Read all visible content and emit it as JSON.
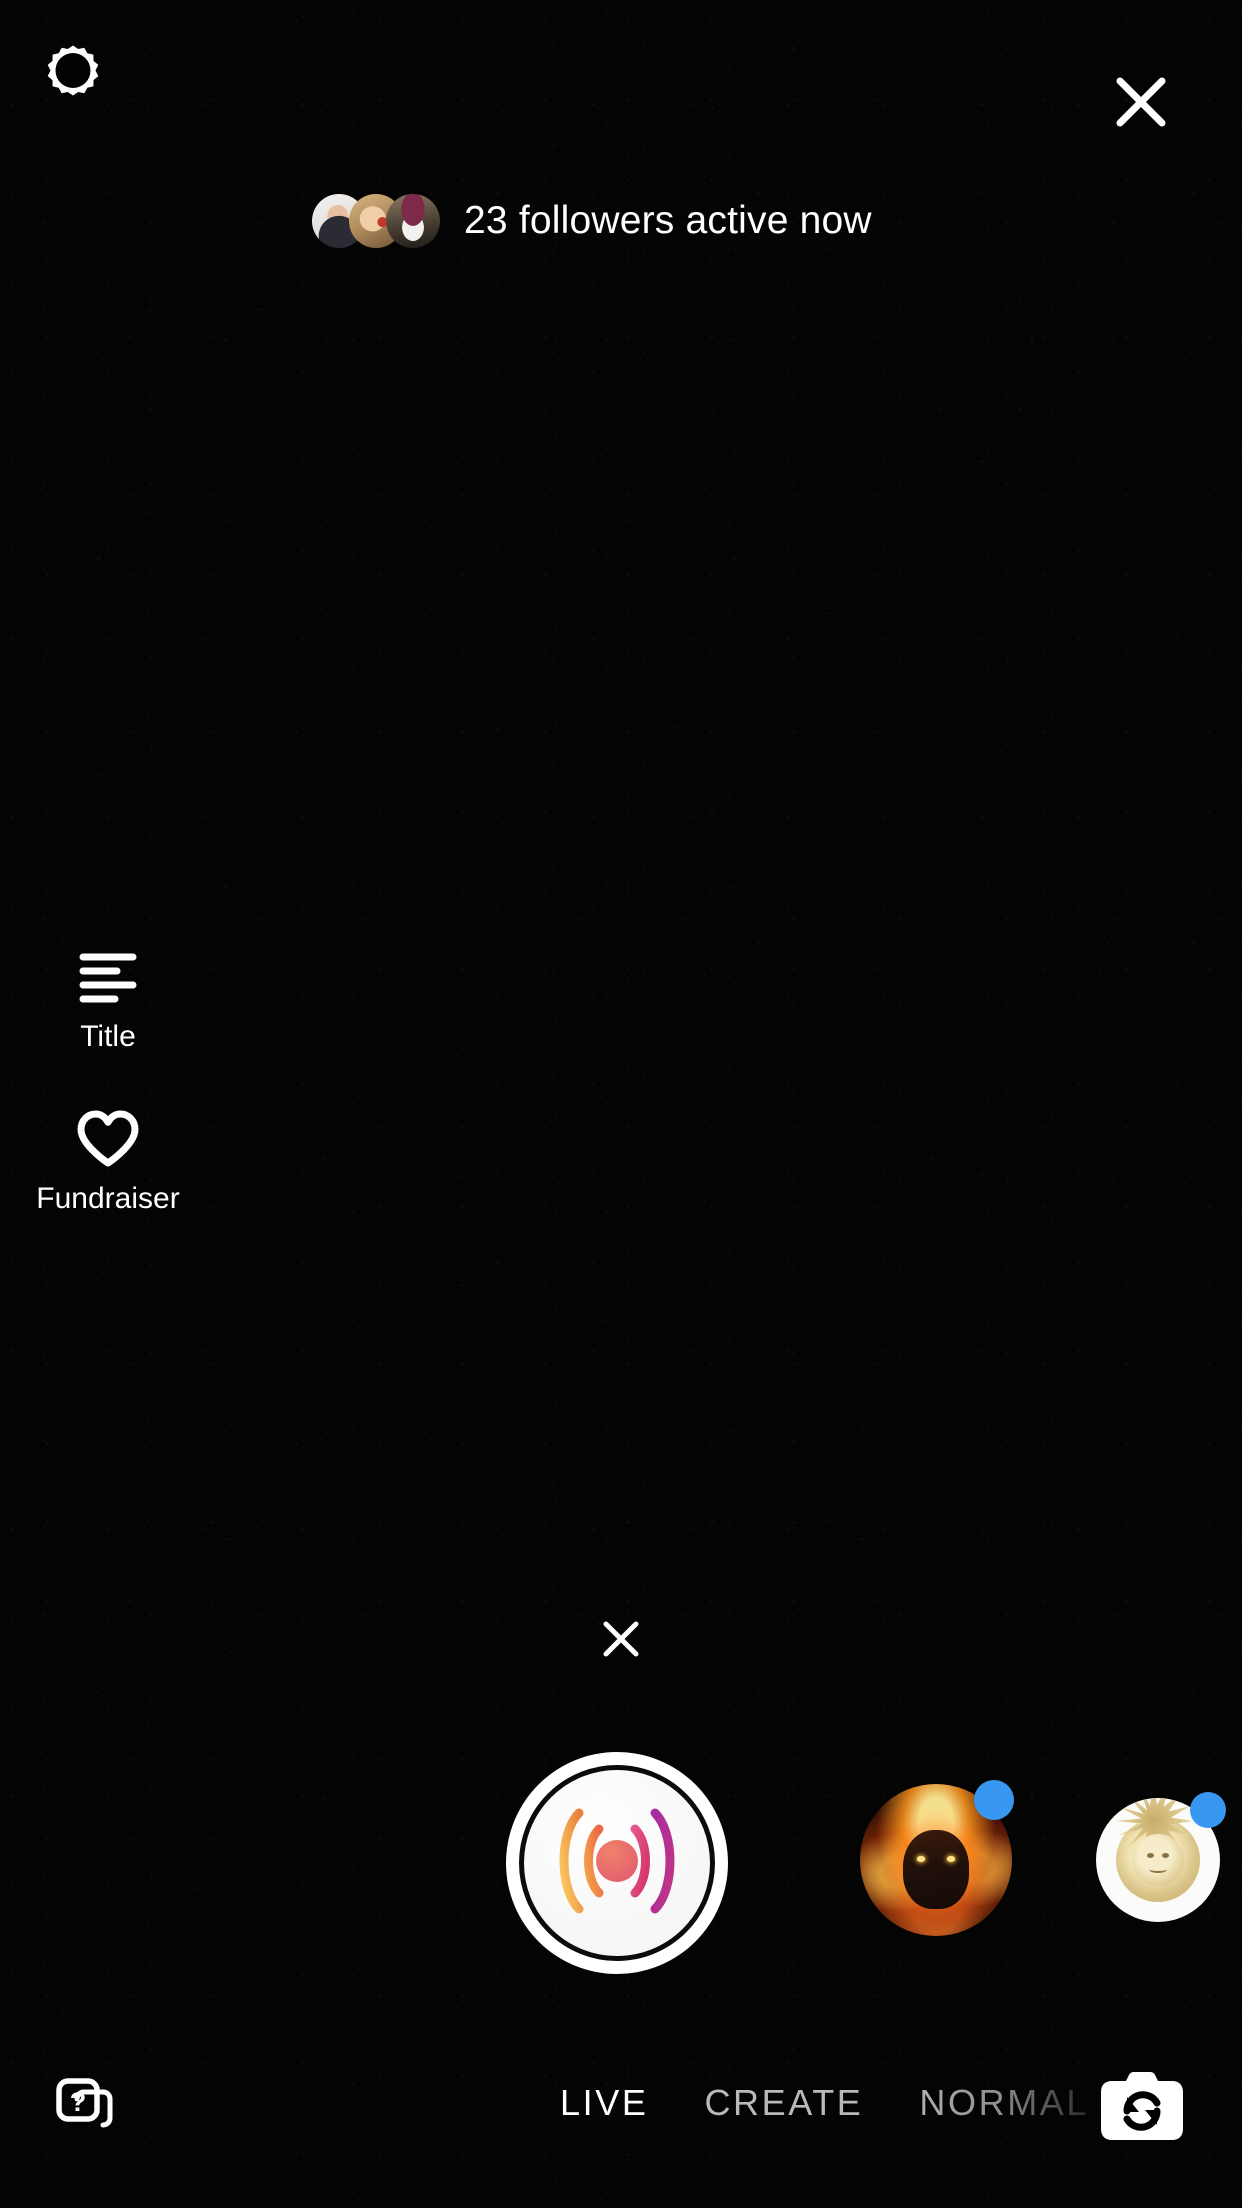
{
  "app": {
    "screen_name": "Instagram Live camera",
    "background_color": "#050404",
    "accent_badge_color": "#3897f0"
  },
  "top_bar": {
    "settings_icon": "gear-icon",
    "settings_label": "Settings",
    "close_icon": "close-icon",
    "close_label": "Close"
  },
  "active_now": {
    "text": "23 followers active now",
    "count": 23,
    "avatars": [
      {
        "alt": "follower-avatar-1"
      },
      {
        "alt": "follower-avatar-2"
      },
      {
        "alt": "follower-avatar-3"
      }
    ]
  },
  "tools": [
    {
      "icon": "title-lines-icon",
      "label": "Title"
    },
    {
      "icon": "heart-icon",
      "label": "Fundraiser"
    }
  ],
  "effect_dismiss": {
    "icon": "close-icon",
    "label": "Remove effect"
  },
  "capture": {
    "icon": "live-broadcast-icon",
    "label": "Go live"
  },
  "effects": [
    {
      "name": "fire-face-effect",
      "label": "Fire face effect",
      "badge": "new",
      "badge_color": "#3897f0"
    },
    {
      "name": "sun-effect",
      "label": "Sun effect",
      "badge": "new",
      "badge_color": "#3897f0"
    }
  ],
  "bottom_bar": {
    "quiz_icon": "quiz-cards-icon",
    "quiz_label": "Quiz sticker",
    "flip_icon": "camera-flip-icon",
    "flip_label": "Flip camera",
    "modes": [
      {
        "label": "LIVE",
        "state": "active"
      },
      {
        "label": "CREATE",
        "state": "dim"
      },
      {
        "label": "NORMAL",
        "state": "faded"
      }
    ]
  }
}
